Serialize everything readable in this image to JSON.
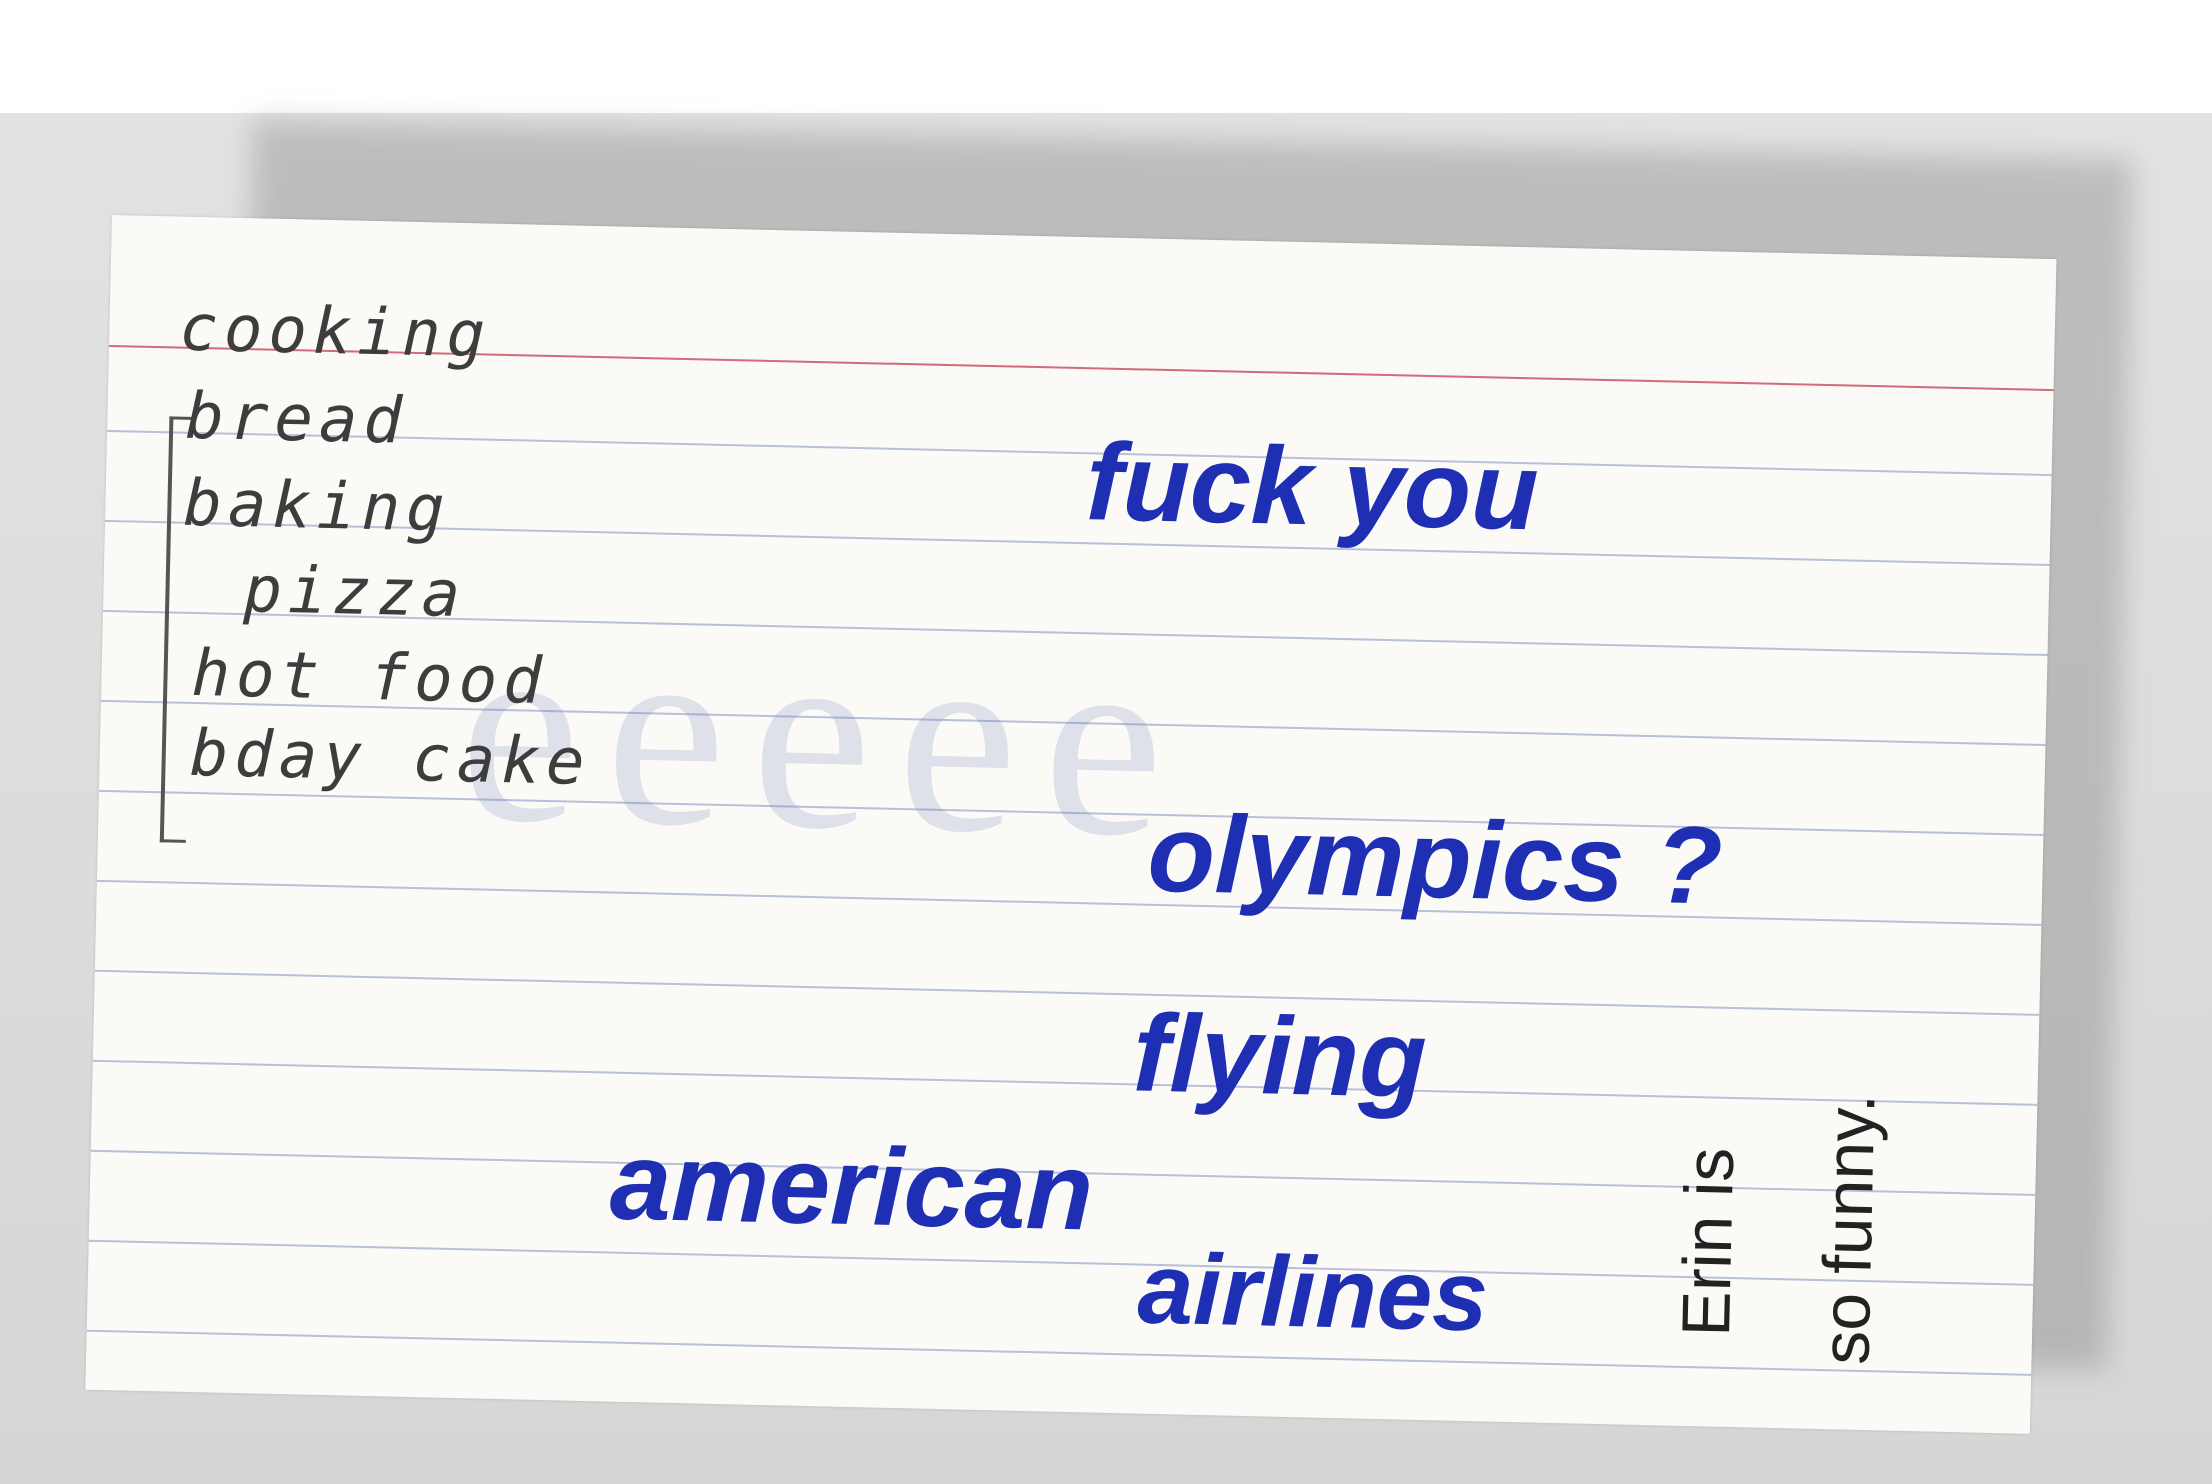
{
  "note_card": {
    "pencil_list": [
      "cooking",
      "bread",
      "baking",
      "pizza",
      "hot food",
      "bday cake"
    ],
    "ink_phrases": {
      "phrase_1": "fuck you",
      "phrase_2": "olympics ?",
      "phrase_3": "flying",
      "phrase_4": "american",
      "phrase_5": "airlines"
    },
    "side_note": {
      "line_1": "Erin is",
      "line_2": "so funny."
    },
    "colors": {
      "ink": "#1f2fb4",
      "pencil": "#3d3d3d",
      "card": "#fbfaf6",
      "rule_lines": "#b7bfd9",
      "margin_line": "#d36b7a"
    }
  }
}
